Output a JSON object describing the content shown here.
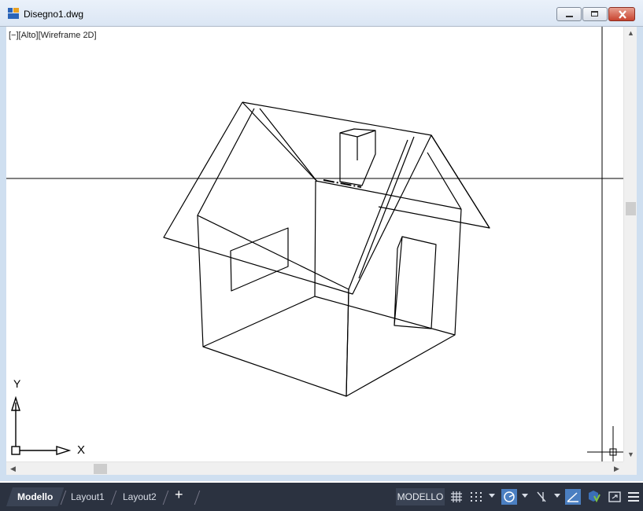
{
  "window": {
    "title": "Disegno1.dwg"
  },
  "viewport": {
    "label": "[−][Alto][Wireframe 2D]",
    "ucs_x_label": "X",
    "ucs_y_label": "Y"
  },
  "tabs": [
    {
      "label": "Modello",
      "active": true
    },
    {
      "label": "Layout1",
      "active": false
    },
    {
      "label": "Layout2",
      "active": false
    }
  ],
  "add_tab_label": "+",
  "status": {
    "model_label": "MODELLO",
    "icons": [
      "grid-icon",
      "snap-icon",
      "dynamic-input-icon",
      "ortho-icon",
      "polar-tracking-icon",
      "isodraft-icon",
      "object-snap-tracking-icon",
      "lineweight-icon",
      "annotation-icon",
      "fullscreen-icon",
      "menu-icon"
    ]
  },
  "colors": {
    "status_bar_bg": "#2b3240",
    "active_icon": "#4b7fc1",
    "window_frame": "#cfdff0",
    "line": "#000000"
  }
}
